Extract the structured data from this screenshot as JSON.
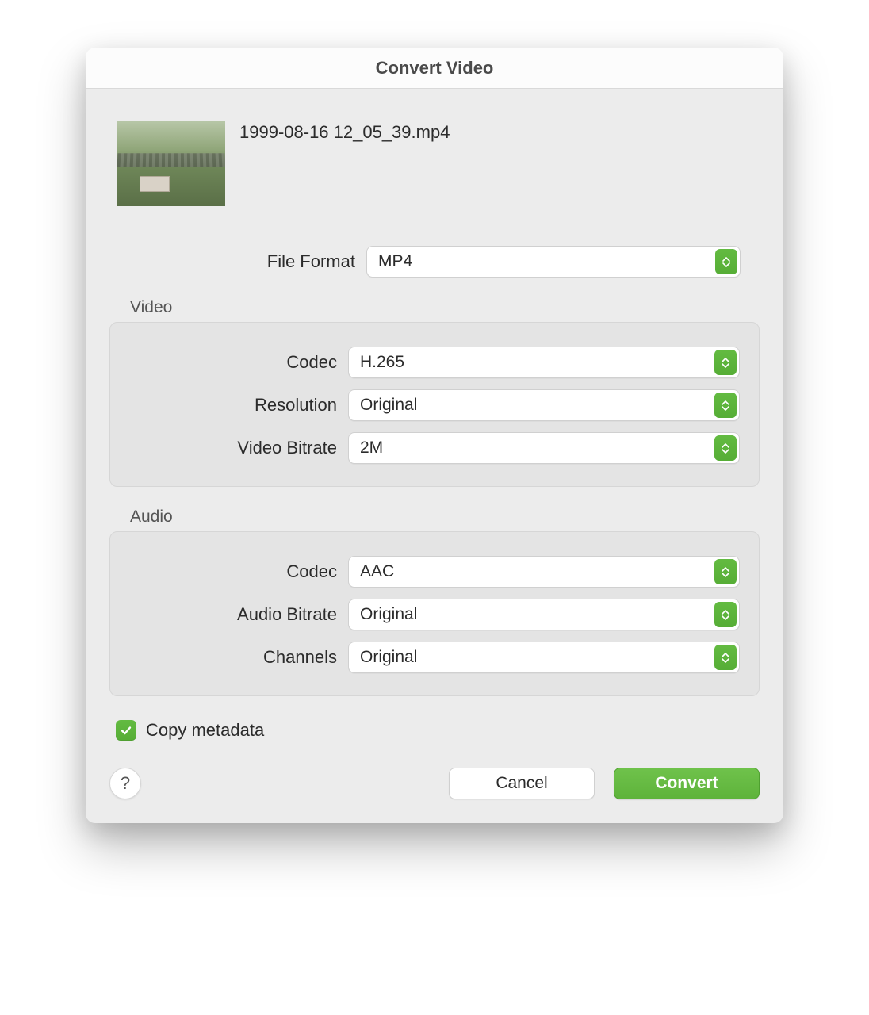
{
  "dialog": {
    "title": "Convert Video",
    "filename": "1999-08-16 12_05_39.mp4"
  },
  "file_format": {
    "label": "File Format",
    "value": "MP4"
  },
  "video": {
    "group_label": "Video",
    "codec": {
      "label": "Codec",
      "value": "H.265"
    },
    "resolution": {
      "label": "Resolution",
      "value": "Original"
    },
    "bitrate": {
      "label": "Video Bitrate",
      "value": "2M"
    }
  },
  "audio": {
    "group_label": "Audio",
    "codec": {
      "label": "Codec",
      "value": "AAC"
    },
    "bitrate": {
      "label": "Audio Bitrate",
      "value": "Original"
    },
    "channels": {
      "label": "Channels",
      "value": "Original"
    }
  },
  "copy_metadata": {
    "label": "Copy metadata",
    "checked": true
  },
  "buttons": {
    "help": "?",
    "cancel": "Cancel",
    "convert": "Convert"
  },
  "colors": {
    "accent": "#5eb33b"
  }
}
